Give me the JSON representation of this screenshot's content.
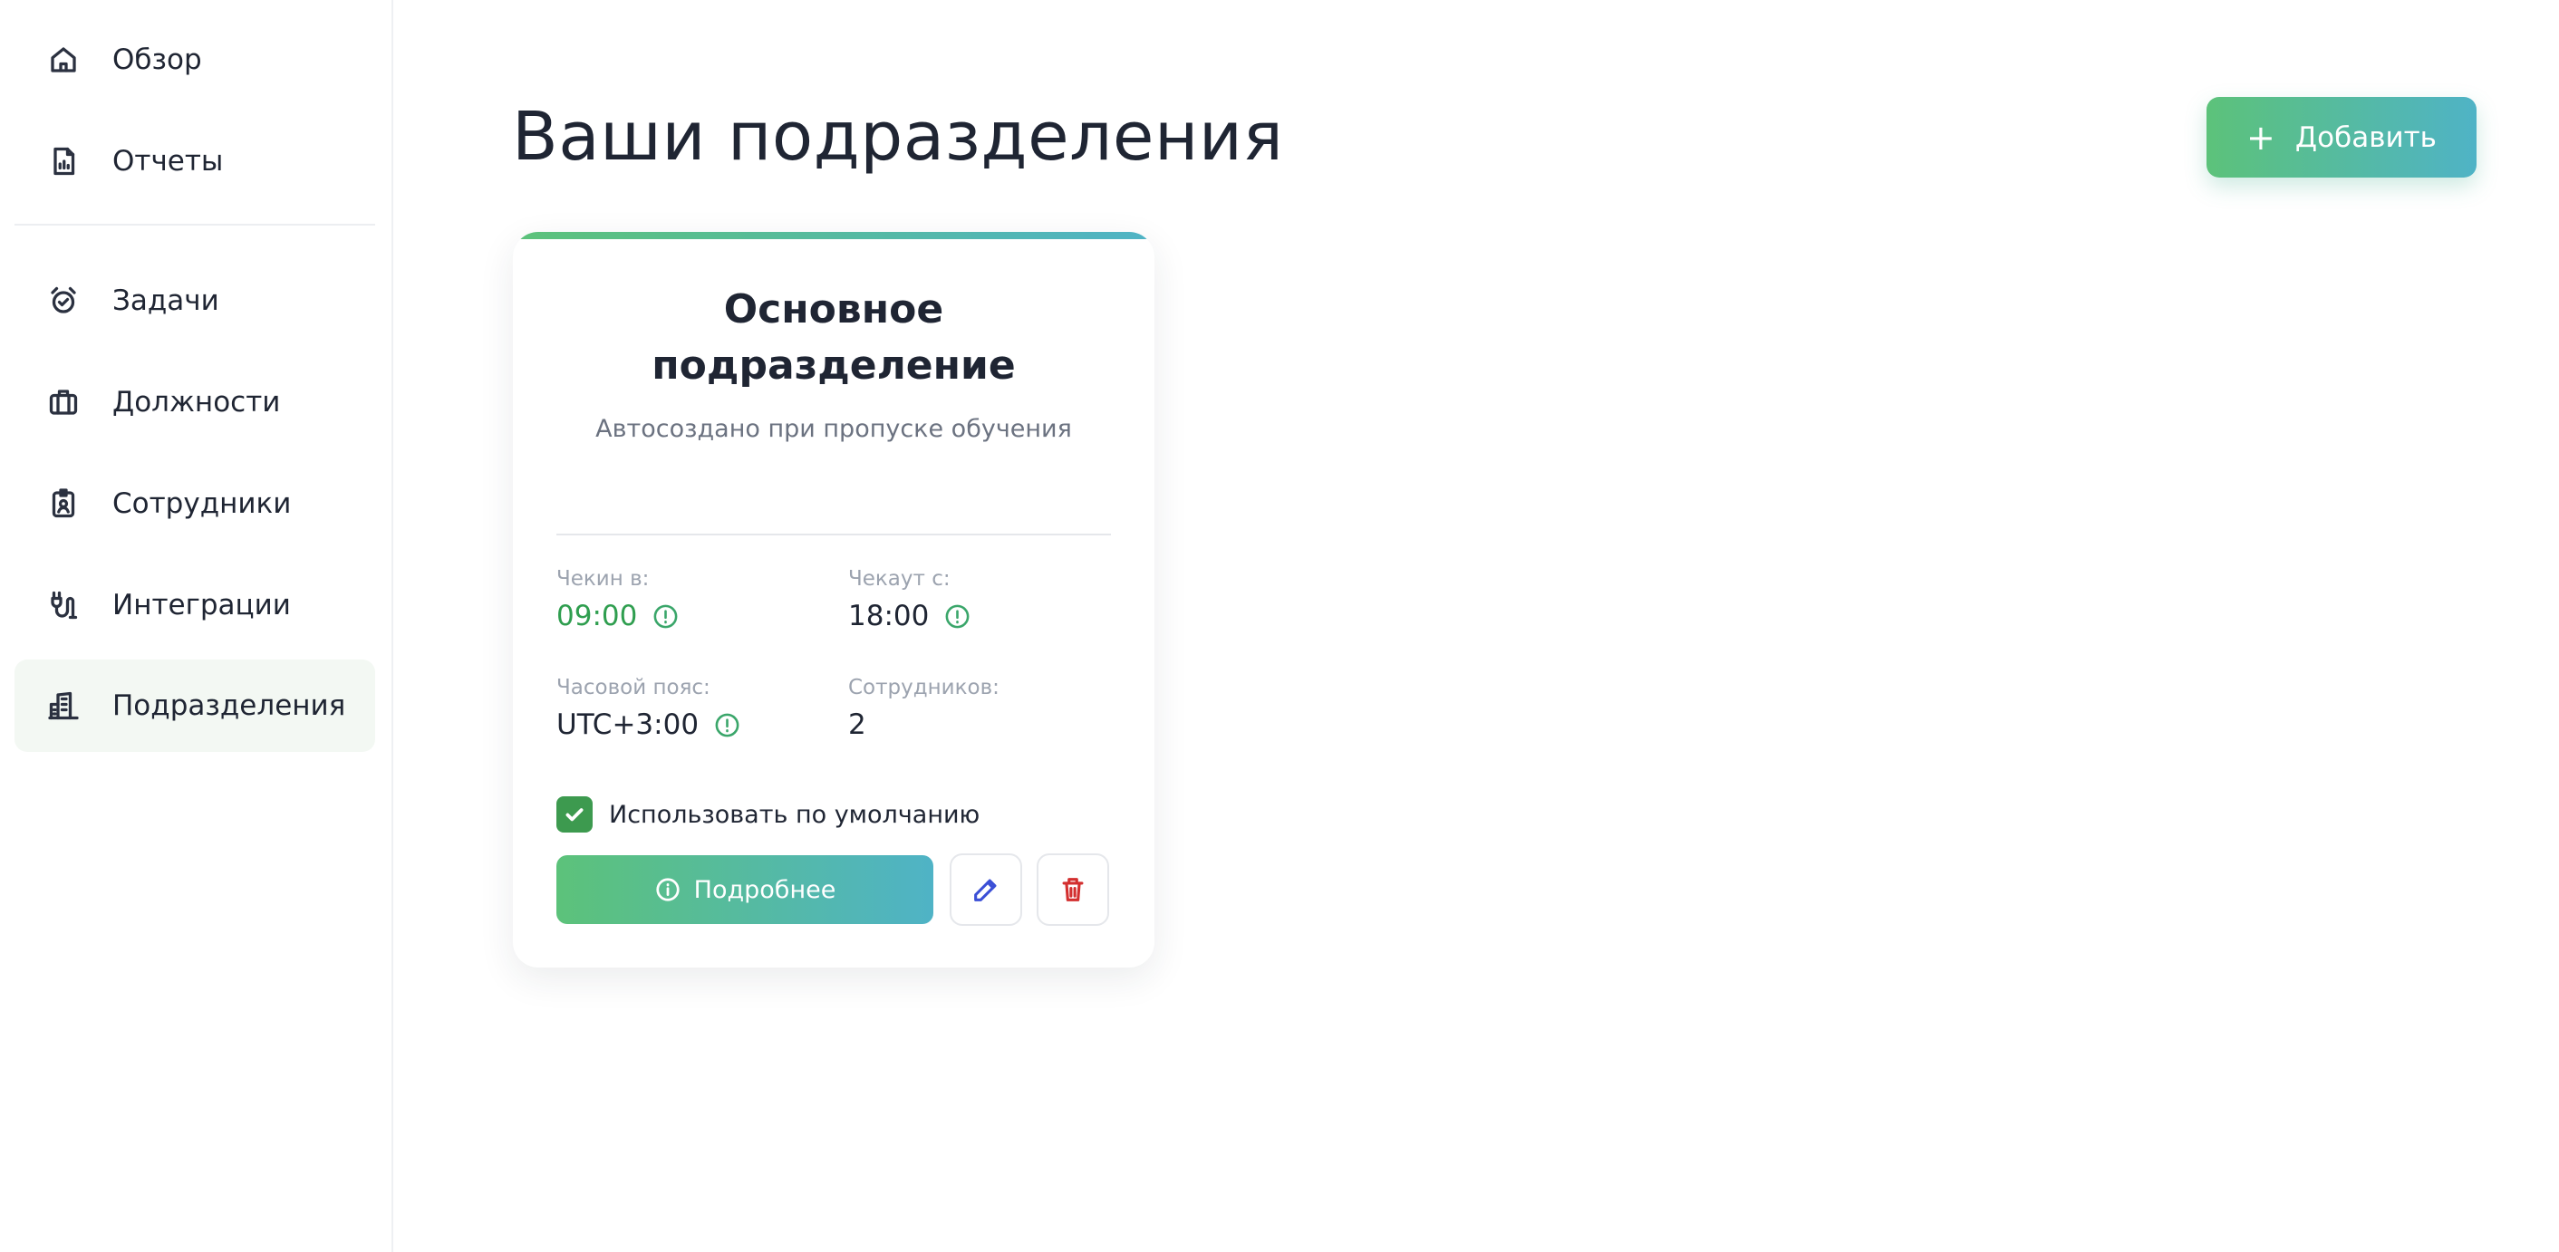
{
  "sidebar": {
    "items": [
      {
        "label": "Обзор",
        "icon": "home-icon"
      },
      {
        "label": "Отчеты",
        "icon": "report-icon"
      },
      {
        "label": "Задачи",
        "icon": "alarm-clock-icon"
      },
      {
        "label": "Должности",
        "icon": "briefcase-icon"
      },
      {
        "label": "Сотрудники",
        "icon": "id-badge-icon"
      },
      {
        "label": "Интеграции",
        "icon": "plug-icon"
      },
      {
        "label": "Подразделения",
        "icon": "building-icon",
        "active": true
      }
    ]
  },
  "header": {
    "title": "Ваши подразделения",
    "add_button": "Добавить"
  },
  "card": {
    "title": "Основное подразделение",
    "subtitle": "Автосоздано при пропуске обучения",
    "checkin_label": "Чекин в:",
    "checkin_value": "09:00",
    "checkout_label": "Чекаут с:",
    "checkout_value": "18:00",
    "timezone_label": "Часовой пояс:",
    "timezone_value": "UTC+3:00",
    "employees_label": "Сотрудников:",
    "employees_value": "2",
    "default_checkbox_label": "Использовать по умолчанию",
    "default_checked": true,
    "details_button": "Подробнее"
  },
  "colors": {
    "accent_start": "#5cc27a",
    "accent_end": "#4fb3c6",
    "checkin_green": "#2f9e4f",
    "edit_blue": "#3b4fd6",
    "delete_red": "#d32f2f"
  }
}
